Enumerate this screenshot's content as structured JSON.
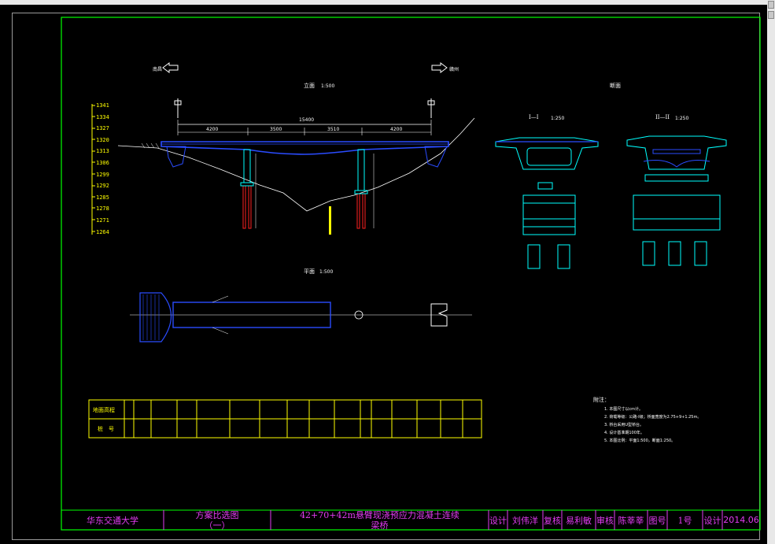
{
  "title_block": {
    "school": "华东交通大学",
    "drawing_title_line1": "方案比选图",
    "drawing_title_line2": "（一）",
    "project_line1": "42+70+42m悬臂现浇预应力混凝土连续",
    "project_line2": "梁桥",
    "design_label": "设计",
    "designer": "刘伟洋",
    "review_label": "复核",
    "reviewer": "易利敏",
    "audit_label": "审核",
    "auditor": "陈莘莘",
    "figno_label": "图号",
    "figno": "1号",
    "design_label2": "设计",
    "date": "2014.06"
  },
  "elevation_labels": [
    "1341",
    "1334",
    "1327",
    "1320",
    "1313",
    "1306",
    "1299",
    "1292",
    "1285",
    "1278",
    "1271",
    "1264"
  ],
  "view_titles": {
    "elevation": "立面",
    "elevation_scale": "1:500",
    "plan": "平面",
    "plan_scale": "1:500",
    "section": "断面",
    "sec1": "I—I",
    "sec1_scale": "1:250",
    "sec2": "II—II",
    "sec2_scale": "1:250"
  },
  "dimensions": {
    "total": "15400",
    "span1": "4200",
    "span2": "3500",
    "span3": "3510",
    "span4": "4200"
  },
  "direction": {
    "left": "南昌",
    "right": "赣州"
  },
  "table": {
    "row1_label": "地面高程",
    "row2_label": "桩　号"
  },
  "notes": {
    "title": "附注：",
    "items": [
      "1. 本图尺寸以cm计。",
      "2. 荷载等级：公路-I级；桥面宽度为2.75+9+1.25m。",
      "3. 桥台采用U型桥台。",
      "4. 设计基准期100年。",
      "5. 本图比例：平面1:500，断面1:250。"
    ]
  },
  "colors": {
    "frame": "#00ff00",
    "cyan": "#00ffff",
    "blue": "#2a4cff",
    "magenta": "#e23cf2",
    "yellow": "#ffff00",
    "red": "#ff2020"
  }
}
